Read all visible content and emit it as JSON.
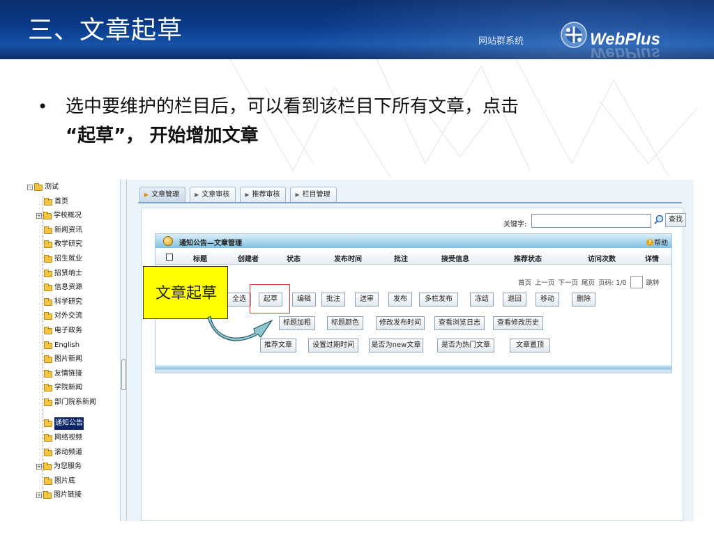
{
  "header": {
    "title": "三、文章起草",
    "brand_sub": "网站群系统",
    "brand_name": "WebPlus"
  },
  "bullet": {
    "line1": "选中要维护的栏目后，可以看到该栏目下所有文章，点击",
    "line2_part1": "“起草”，",
    "line2_part2": "开始增加文章"
  },
  "tree": {
    "items": [
      {
        "label": "测试"
      },
      {
        "label": "首页"
      },
      {
        "label": "学校概况"
      },
      {
        "label": "新闻资讯"
      },
      {
        "label": "教学研究"
      },
      {
        "label": "招生就业"
      },
      {
        "label": "招贤纳士"
      },
      {
        "label": "信息资源"
      },
      {
        "label": "科学研究"
      },
      {
        "label": "对外交流"
      },
      {
        "label": "电子政务"
      },
      {
        "label": "English"
      },
      {
        "label": "图片新闻"
      },
      {
        "label": "友情链接"
      },
      {
        "label": "学院新闻"
      },
      {
        "label": "部门院系新闻"
      },
      {
        "label": "通知公告"
      },
      {
        "label": "网络视频"
      },
      {
        "label": "滚动频道"
      },
      {
        "label": "为您服务"
      },
      {
        "label": "图片底"
      },
      {
        "label": "图片链接"
      }
    ]
  },
  "tabs": [
    {
      "label": "文章管理"
    },
    {
      "label": "文章审核"
    },
    {
      "label": "推荐审核"
    },
    {
      "label": "栏目管理"
    }
  ],
  "search": {
    "label": "关键字:",
    "value": "",
    "button": "查找"
  },
  "panel": {
    "title": "通知公告—文章管理",
    "help": "帮助"
  },
  "columns": [
    "标题",
    "创建者",
    "状态",
    "发布时间",
    "批注",
    "接受信息",
    "推荐状态",
    "访问次数",
    "详情"
  ],
  "pager": {
    "first": "首页",
    "prev": "上一页",
    "next": "下一页",
    "last": "尾页",
    "page_info": "页码: 1/0",
    "jump": "跳转"
  },
  "buttons_row1": [
    "全选",
    "起草",
    "编辑",
    "批注",
    "送审",
    "发布",
    "多栏发布",
    "冻结",
    "退回",
    "移动",
    "删除"
  ],
  "buttons_row2": [
    "标题加粗",
    "标题颜色",
    "修改发布时间",
    "查看浏览日志",
    "查看修改历史"
  ],
  "buttons_row3": [
    "推荐文章",
    "设置过期时间",
    "是否为new文章",
    "是否为热门文章",
    "文章置顶"
  ],
  "callout": {
    "text": "文章起草"
  },
  "colors": {
    "header_blue": "#0a3a8a",
    "callout_yellow": "#ffff00",
    "highlight_red": "#e03030",
    "arrow_teal": "#8cc6d0"
  }
}
